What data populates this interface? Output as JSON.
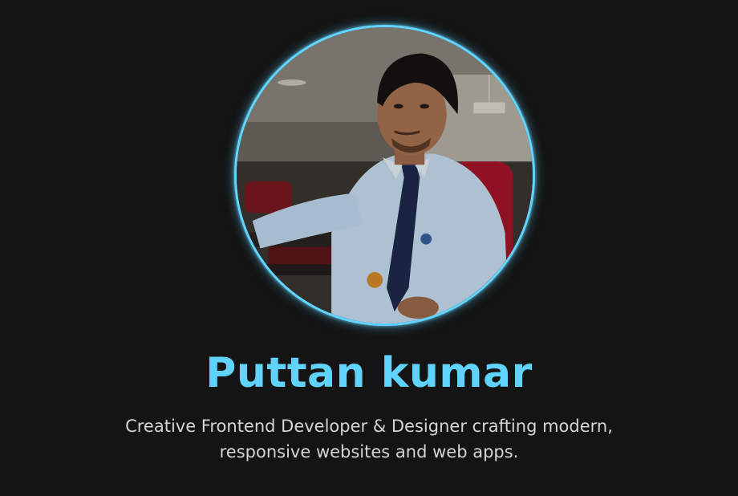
{
  "hero": {
    "avatar_icon": "profile-photo",
    "name": "Puttan kumar",
    "tagline": "Creative Frontend Developer & Designer crafting modern, responsive websites and web apps."
  },
  "colors": {
    "background": "#141414",
    "accent": "#5fd3fb",
    "text": "#d4d4d4"
  }
}
